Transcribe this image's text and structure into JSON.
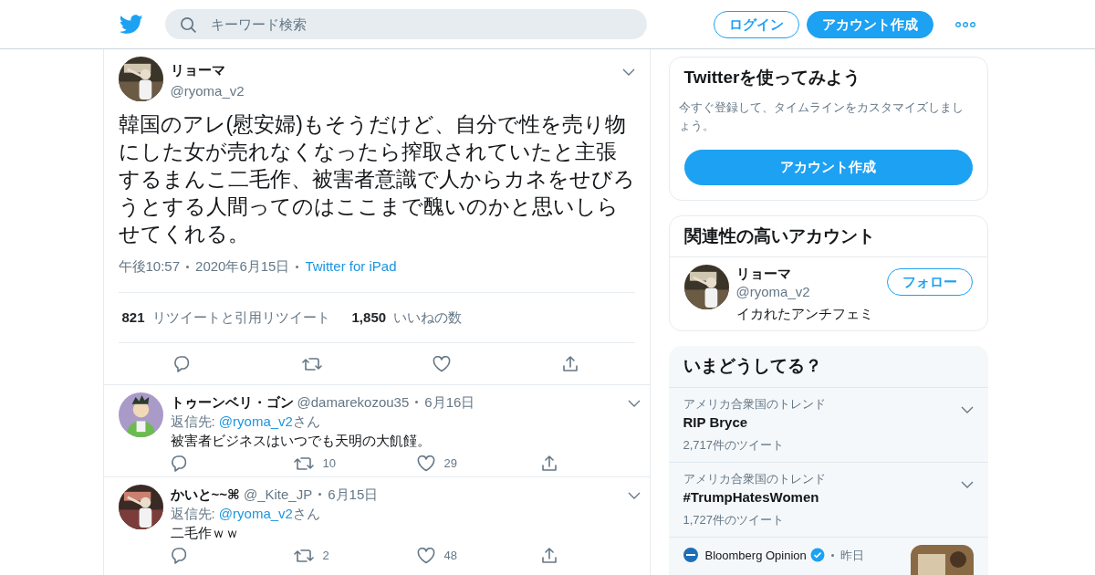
{
  "header": {
    "search": {
      "placeholder": "キーワード検索"
    },
    "login": "ログイン",
    "signup": "アカウント作成"
  },
  "tweet": {
    "name": "リョーマ",
    "handle": "@ryoma_v2",
    "text": "韓国のアレ(慰安婦)もそうだけど、自分で性を売り物にした女が売れなくなったら搾取されていたと主張するまんこ二毛作、被害者意識で人からカネをせびろうとする人間ってのはここまで醜いのかと思いしらせてくれる。",
    "time": "午後10:57",
    "date": "2020年6月15日",
    "source": "Twitter for iPad",
    "retweets": {
      "count": "821",
      "label": "リツイートと引用リツイート"
    },
    "likes": {
      "count": "1,850",
      "label": "いいねの数"
    }
  },
  "replies": [
    {
      "name": "トゥーンベリ・ゴン",
      "handle": "@damarekozou35",
      "date": "6月16日",
      "reply_prefix": "返信先: ",
      "reply_to": "@ryoma_v2",
      "reply_suffix": "さん",
      "text": "被害者ビジネスはいつでも天明の大飢饉。",
      "retweets": "10",
      "likes": "29"
    },
    {
      "name": "かいと~~⌘",
      "handle": "@_Kite_JP",
      "date": "6月15日",
      "reply_prefix": "返信先: ",
      "reply_to": "@ryoma_v2",
      "reply_suffix": "さん",
      "text": "二毛作ｗｗ",
      "retweets": "2",
      "likes": "48"
    }
  ],
  "sidebar": {
    "signup_card": {
      "title": "Twitterを使ってみよう",
      "text": "今すぐ登録して、タイムラインをカスタマイズしましょう。",
      "button": "アカウント作成"
    },
    "related": {
      "title": "関連性の高いアカウント",
      "accounts": [
        {
          "name": "リョーマ",
          "handle": "@ryoma_v2",
          "bio": "イカれたアンチフェミ",
          "follow": "フォロー"
        }
      ]
    },
    "trends": {
      "title": "いまどうしてる？",
      "items": [
        {
          "kind": "trend",
          "context": "アメリカ合衆国のトレンド",
          "name": "RIP Bryce",
          "count": "2,717件のツイート"
        },
        {
          "kind": "trend",
          "context": "アメリカ合衆国のトレンド",
          "name": "#TrumpHatesWomen",
          "count": "1,727件のツイート"
        },
        {
          "kind": "news",
          "source": "Bloomberg Opinion",
          "verified": true,
          "time": "昨日"
        }
      ]
    }
  }
}
